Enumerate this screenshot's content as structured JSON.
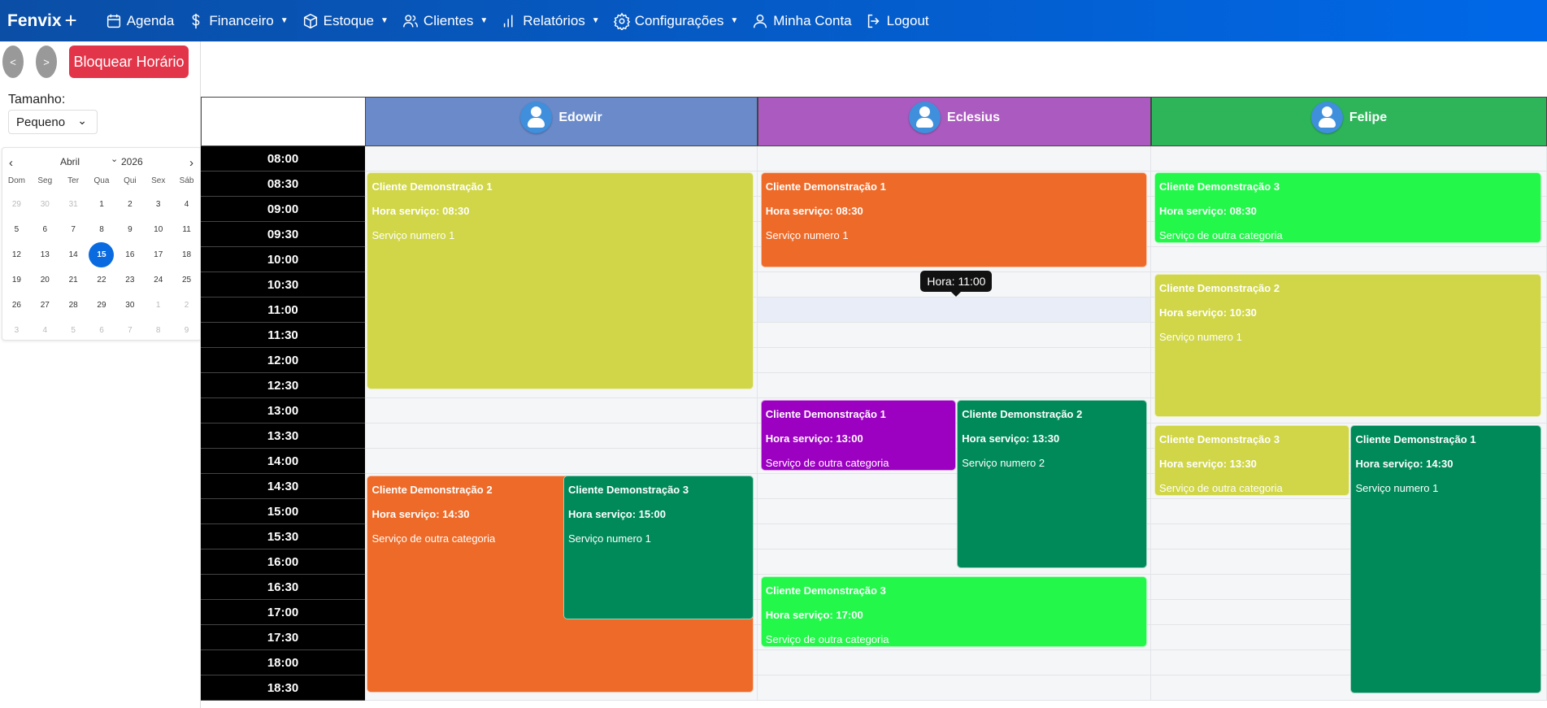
{
  "nav": {
    "brand": "Fenvix",
    "items": [
      {
        "label": "Agenda",
        "icon": "calendar-icon",
        "dropdown": false
      },
      {
        "label": "Financeiro",
        "icon": "dollar-icon",
        "dropdown": true
      },
      {
        "label": "Estoque",
        "icon": "box-icon",
        "dropdown": true
      },
      {
        "label": "Clientes",
        "icon": "users-icon",
        "dropdown": true
      },
      {
        "label": "Relatórios",
        "icon": "bar-chart-icon",
        "dropdown": true
      },
      {
        "label": "Configurações",
        "icon": "gear-icon",
        "dropdown": true
      },
      {
        "label": "Minha Conta",
        "icon": "user-icon",
        "dropdown": false
      },
      {
        "label": "Logout",
        "icon": "logout-icon",
        "dropdown": false
      }
    ]
  },
  "sidebar": {
    "prev": "<",
    "next": ">",
    "block_button": "Bloquear Horário",
    "size_label": "Tamanho:",
    "size_value": "Pequeno",
    "calendar": {
      "month": "Abril",
      "year": "2026",
      "weekdays": [
        "Dom",
        "Seg",
        "Ter",
        "Qua",
        "Qui",
        "Sex",
        "Sáb"
      ],
      "days": [
        "29",
        "30",
        "31",
        "1",
        "2",
        "3",
        "4",
        "5",
        "6",
        "7",
        "8",
        "9",
        "10",
        "11",
        "12",
        "13",
        "14",
        "15",
        "16",
        "17",
        "18",
        "19",
        "20",
        "21",
        "22",
        "23",
        "24",
        "25",
        "26",
        "27",
        "28",
        "29",
        "30",
        "1",
        "2",
        "3",
        "4",
        "5",
        "6",
        "7",
        "8",
        "9"
      ],
      "selected": "15"
    }
  },
  "staff": [
    {
      "name": "Edowir",
      "color": "#6a8aca"
    },
    {
      "name": "Eclesius",
      "color": "#ab5bbf"
    },
    {
      "name": "Felipe",
      "color": "#2eb55a"
    }
  ],
  "times": [
    "08:00",
    "08:30",
    "09:00",
    "09:30",
    "10:00",
    "10:30",
    "11:00",
    "11:30",
    "12:00",
    "12:30",
    "13:00",
    "13:30",
    "14:00",
    "14:30",
    "15:00",
    "15:30",
    "16:00",
    "16:30",
    "17:00",
    "17:30",
    "18:00",
    "18:30"
  ],
  "events": [
    {
      "staff": "Edowir",
      "client": "Cliente Demonstração 1",
      "time": "Hora serviço: 08:30",
      "service": "Serviço numero 1",
      "color": "#d0d647"
    },
    {
      "staff": "Edowir",
      "client": "Cliente Demonstração 2",
      "time": "Hora serviço: 14:30",
      "service": "Serviço de outra categoria",
      "color": "#ee6a28"
    },
    {
      "staff": "Edowir",
      "client": "Cliente Demonstração 3",
      "time": "Hora serviço: 15:00",
      "service": "Serviço numero 1",
      "color": "#008a5a"
    },
    {
      "staff": "Eclesius",
      "client": "Cliente Demonstração 1",
      "time": "Hora serviço: 08:30",
      "service": "Serviço numero 1",
      "color": "#ee6a28"
    },
    {
      "staff": "Eclesius",
      "client": "Cliente Demonstração 1",
      "time": "Hora serviço: 13:00",
      "service": "Serviço de outra categoria",
      "color": "#9c00c1"
    },
    {
      "staff": "Eclesius",
      "client": "Cliente Demonstração 2",
      "time": "Hora serviço: 13:30",
      "service": "Serviço numero 2",
      "color": "#008a5a"
    },
    {
      "staff": "Eclesius",
      "client": "Cliente Demonstração 3",
      "time": "Hora serviço: 17:00",
      "service": "Serviço de outra categoria",
      "color": "#22f74a"
    },
    {
      "staff": "Felipe",
      "client": "Cliente Demonstração 3",
      "time": "Hora serviço: 08:30",
      "service": "Serviço de outra categoria",
      "color": "#22f74a"
    },
    {
      "staff": "Felipe",
      "client": "Cliente Demonstração 2",
      "time": "Hora serviço: 10:30",
      "service": "Serviço numero 1",
      "color": "#d0d647"
    },
    {
      "staff": "Felipe",
      "client": "Cliente Demonstração 3",
      "time": "Hora serviço: 13:30",
      "service": "Serviço de outra categoria",
      "color": "#d0d647"
    },
    {
      "staff": "Felipe",
      "client": "Cliente Demonstração 1",
      "time": "Hora serviço: 14:30",
      "service": "Serviço numero 1",
      "color": "#008a5a"
    }
  ],
  "tooltip": "Hora: 11:00"
}
